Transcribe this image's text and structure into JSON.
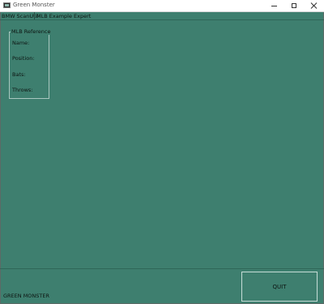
{
  "window": {
    "title": "Green Monster",
    "icon": "app-window-icon"
  },
  "menubar": {
    "items": [
      {
        "label": "BMW ScanUtil"
      },
      {
        "label": "MLB Example Expert"
      }
    ]
  },
  "reference_group": {
    "title": "MLB Reference",
    "fields": [
      {
        "label": "Name:"
      },
      {
        "label": "Position:"
      },
      {
        "label": "Bats:"
      },
      {
        "label": "Throws:"
      }
    ]
  },
  "footer": {
    "status_label": "GREEN MONSTER",
    "quit_label": "QUIT"
  },
  "colors": {
    "background": "#3e7f6f",
    "titlebar": "#ffffff",
    "text": "#0d1512"
  }
}
